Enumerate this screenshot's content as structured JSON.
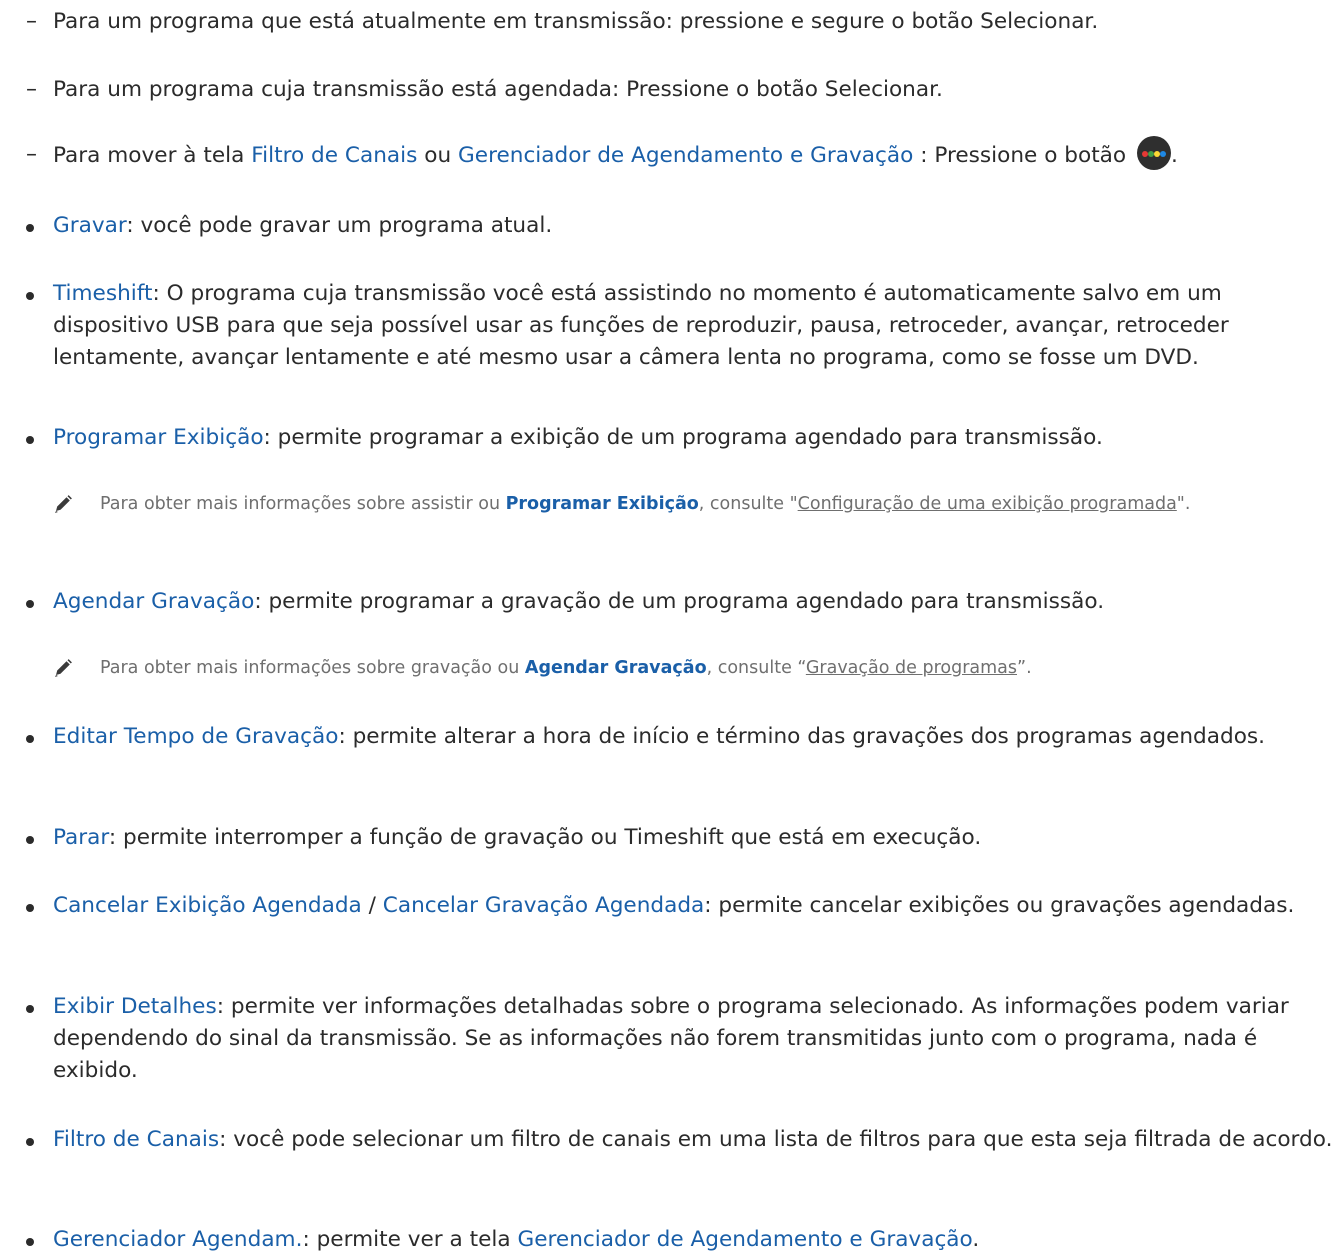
{
  "items": [
    {
      "id": "transmissao_atual",
      "kind": "dash",
      "text": "Para um programa que está atualmente em transmissão: pressione e segure o botão Selecionar."
    },
    {
      "id": "transmissao_agendada",
      "kind": "dash",
      "text": "Para um programa cuja transmissão está agendada: Pressione o botão Selecionar."
    },
    {
      "id": "mover_tela",
      "kind": "dash",
      "prefix": "Para mover à tela ",
      "link1": "Filtro de Canais",
      "mid": " ou ",
      "link2": "Gerenciador de Agendamento e Gravação",
      "suffix": " : Pressione o botão ",
      "end": "."
    },
    {
      "id": "gravar",
      "kind": "bullet",
      "term": "Gravar",
      "desc": ": você pode gravar um programa atual."
    },
    {
      "id": "timeshift",
      "kind": "bullet",
      "term": "Timeshift",
      "desc": ": O programa cuja transmissão você está assistindo no momento é automaticamente salvo em um dispositivo USB para que seja possível usar as funções de reproduzir, pausa, retroceder, avançar, retroceder lentamente, avançar lentamente e até mesmo usar a câmera lenta no programa, como se fosse um DVD."
    },
    {
      "id": "programar_exibicao",
      "kind": "bullet",
      "term": "Programar Exibição",
      "desc": ": permite programar a exibição de um programa agendado para transmissão."
    },
    {
      "id": "nota_exibicao",
      "kind": "note",
      "prefix": "Para obter mais informações sobre assistir ou ",
      "term": "Programar Exibição",
      "mid": ", consulte \"",
      "link": "Configuração de uma exibição programada",
      "end": "\"."
    },
    {
      "id": "agendar_gravacao",
      "kind": "bullet",
      "term": "Agendar Gravação",
      "desc": ": permite programar a gravação de um programa agendado para transmissão."
    },
    {
      "id": "nota_gravacao",
      "kind": "note",
      "prefix": "Para obter mais informações sobre gravação ou ",
      "term": "Agendar Gravação",
      "mid": ", consulte “",
      "link": "Gravação de programas",
      "end": "”."
    },
    {
      "id": "editar_tempo",
      "kind": "bullet",
      "term": "Editar Tempo de Gravação",
      "desc": ": permite alterar a hora de início e término das gravações dos programas agendados."
    },
    {
      "id": "parar",
      "kind": "bullet",
      "term": "Parar",
      "desc": ": permite interromper a função de gravação ou Timeshift que está em execução."
    },
    {
      "id": "cancelar",
      "kind": "bullet",
      "term": "Cancelar Exibição Agendada",
      "sep": " / ",
      "term2": "Cancelar Gravação Agendada",
      "desc": ": permite cancelar exibições ou gravações agendadas."
    },
    {
      "id": "exibir_detalhes",
      "kind": "bullet",
      "term": "Exibir Detalhes",
      "desc": ": permite ver informações detalhadas sobre o programa selecionado. As informações podem variar dependendo do sinal da transmissão. Se as informações não forem transmitidas junto com o programa, nada é exibido."
    },
    {
      "id": "filtro_canais",
      "kind": "bullet",
      "term": "Filtro de Canais",
      "desc": ": você pode selecionar um filtro de canais em uma lista de filtros para que esta seja filtrada de acordo."
    },
    {
      "id": "gerenciador",
      "kind": "bullet",
      "term": "Gerenciador Agendam.",
      "desc": ": permite ver a tela ",
      "term2": "Gerenciador de Agendamento e Gravação",
      "end": "."
    }
  ],
  "icons": {
    "note": "pencil-icon",
    "color_button": "color-button-icon"
  },
  "colors": {
    "link": "#1a5fa8",
    "text": "#2b2b2b",
    "note_text": "#6f6f6f",
    "dot_red": "#e53935",
    "dot_green": "#43a047",
    "dot_yellow": "#fdd835",
    "dot_blue": "#1e88e5"
  }
}
